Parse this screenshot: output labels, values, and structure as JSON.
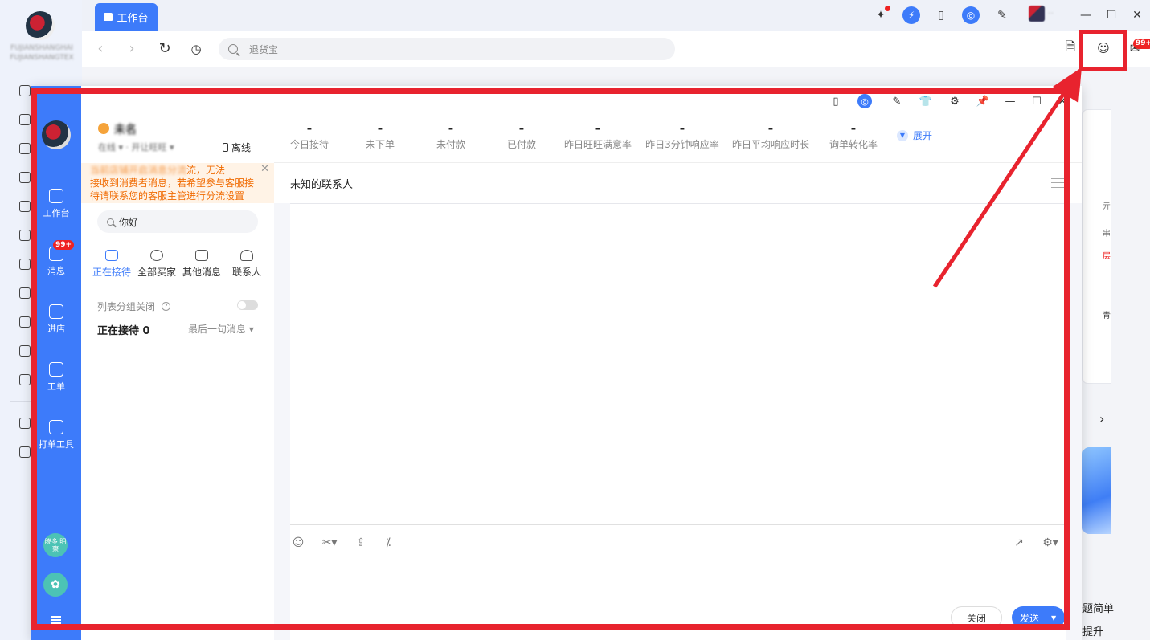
{
  "outer": {
    "tab_label": "工作台",
    "search_placeholder": "退货宝",
    "shop_name_blurred": "FUJIANSHANGHAI FUJIANSHANGTEX",
    "message_badge": "99+",
    "text_fragments": [
      "亓",
      "串",
      "层",
      "青",
      "题简单",
      "提升"
    ]
  },
  "popup": {
    "rail": {
      "items": [
        {
          "label": "工作台"
        },
        {
          "label": "消息",
          "badge": "99+"
        },
        {
          "label": "进店"
        },
        {
          "label": "工单"
        },
        {
          "label": "打单工具"
        }
      ],
      "bottom_app_1": "晓多 明察"
    },
    "profile": {
      "name": "未名",
      "sub": "在线 ▾  · 开让旺旺 ▾",
      "status": "离线"
    },
    "stats": [
      {
        "value": "-",
        "label": "今日接待"
      },
      {
        "value": "-",
        "label": "未下单"
      },
      {
        "value": "-",
        "label": "未付款"
      },
      {
        "value": "-",
        "label": "已付款"
      },
      {
        "value": "-",
        "label": "昨日旺旺满意率"
      },
      {
        "value": "-",
        "label": "昨日3分钟响应率"
      },
      {
        "value": "-",
        "label": "昨日平均响应时长"
      },
      {
        "value": "-",
        "label": "询单转化率"
      }
    ],
    "expand_label": "展开",
    "warning": {
      "blurred_lead": "当前店铺开启消息分流",
      "text_1": "流，无法",
      "text_2": "接收到消费者消息，若希望参与客服接",
      "text_3": "待请联系您的客服主管进行分流设置"
    },
    "search_value": "你好",
    "tabs": [
      {
        "label": "正在接待",
        "active": true
      },
      {
        "label": "全部买家"
      },
      {
        "label": "其他消息"
      },
      {
        "label": "联系人"
      }
    ],
    "group_toggle_label": "列表分组关闭",
    "receiving_label": "正在接待 0",
    "sort_label": "最后一句消息 ▾",
    "chat": {
      "contact_title": "未知的联系人",
      "close_button": "关闭",
      "send_button": "发送"
    }
  },
  "colors": {
    "brand_blue": "#3d7bfa",
    "annotation_red": "#e8232e",
    "warning_orange": "#f06a00"
  }
}
